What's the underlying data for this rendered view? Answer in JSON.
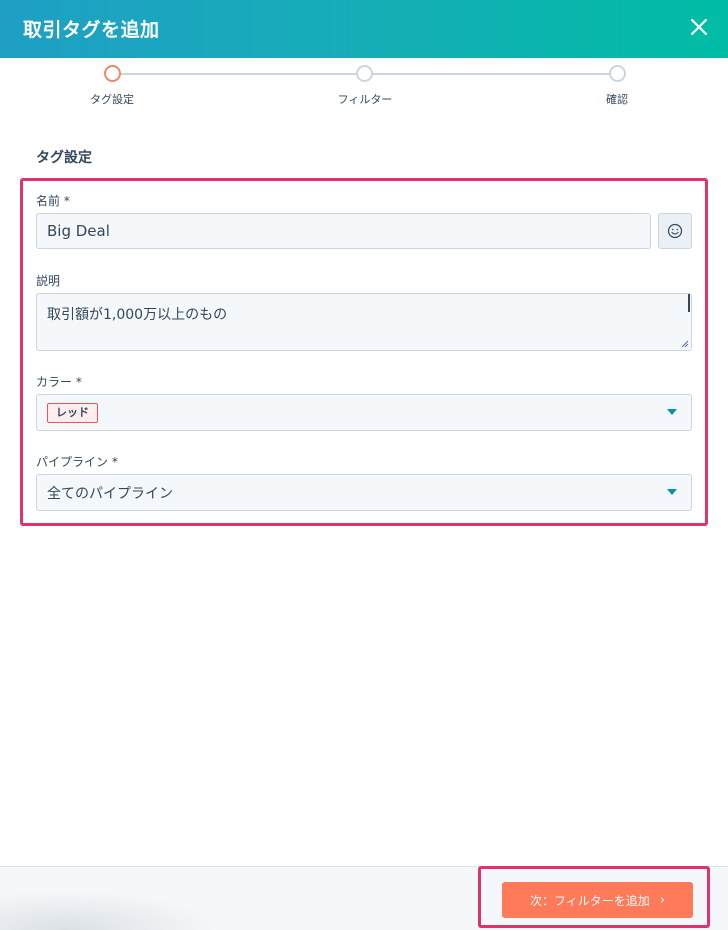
{
  "header": {
    "title": "取引タグを追加",
    "close_icon": "close-icon"
  },
  "stepper": {
    "steps": [
      {
        "label": "タグ設定",
        "active": true
      },
      {
        "label": "フィルター",
        "active": false
      },
      {
        "label": "確認",
        "active": false
      }
    ]
  },
  "section": {
    "title": "タグ設定"
  },
  "form": {
    "name": {
      "label": "名前 *",
      "value": "Big Deal",
      "emoji_icon": "smiley-icon"
    },
    "description": {
      "label": "説明",
      "value": "取引額が1,000万以上のもの"
    },
    "color": {
      "label": "カラー *",
      "selected": "レッド",
      "tag_color": "#f2545b"
    },
    "pipeline": {
      "label": "パイプライン *",
      "selected": "全てのパイプライン"
    }
  },
  "footer": {
    "next_label": "次：フィルターを追加",
    "next_icon": "chevron-right-icon"
  },
  "colors": {
    "accent": "#ff7a59",
    "header_start": "#1e9fc4",
    "header_end": "#00bda5",
    "highlight": "#e0336c"
  }
}
